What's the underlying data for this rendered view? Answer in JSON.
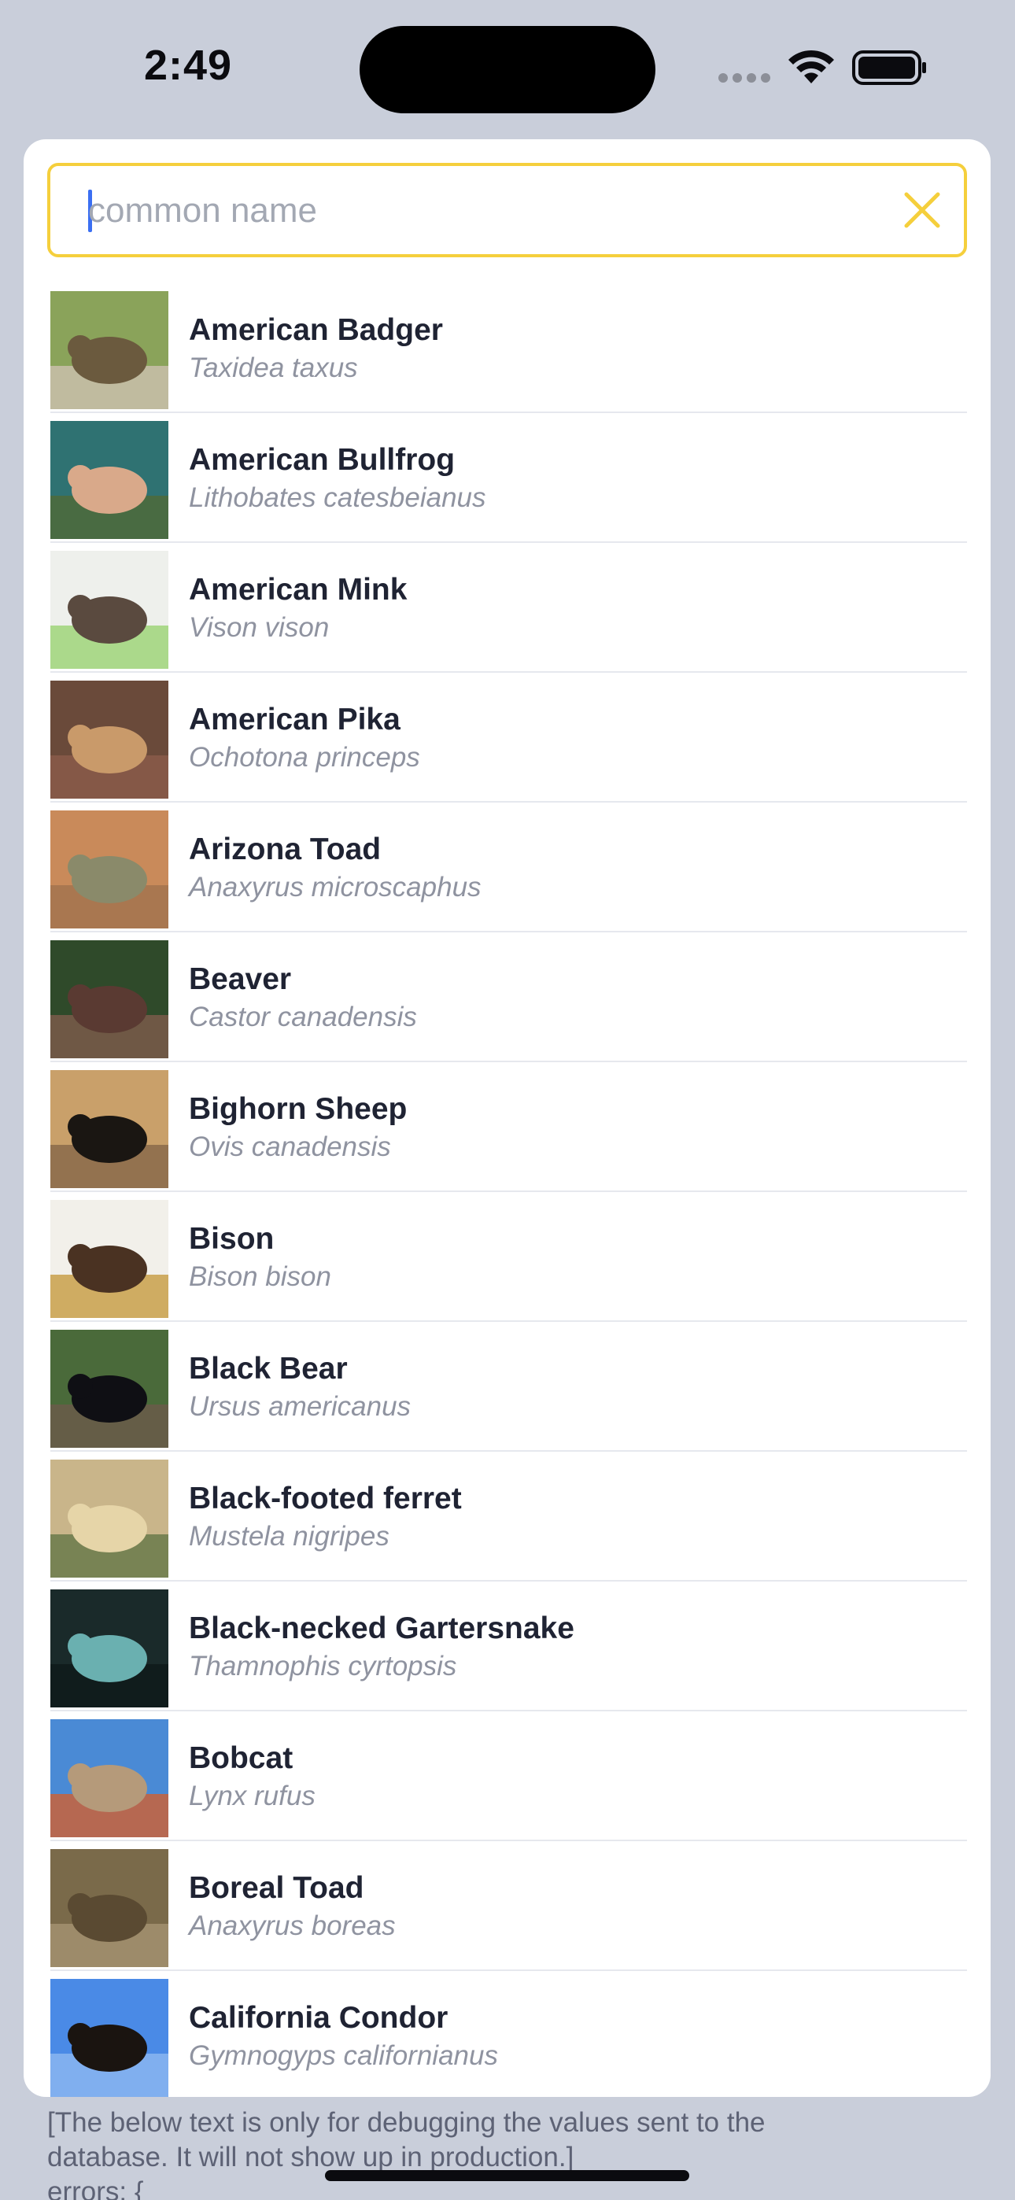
{
  "status_bar": {
    "time": "2:49"
  },
  "search": {
    "placeholder": "common name",
    "value": "",
    "clear_icon": "close-x-icon",
    "accent_color": "#f5cf3c"
  },
  "species": [
    {
      "common": "American Badger",
      "scientific": "Taxidea taxus",
      "colors": [
        "#8aa35a",
        "#6b5a3e",
        "#c9c0ac"
      ]
    },
    {
      "common": "American Bullfrog",
      "scientific": "Lithobates catesbeianus",
      "colors": [
        "#2f7272",
        "#d9a98a",
        "#4d6a3a"
      ]
    },
    {
      "common": "American Mink",
      "scientific": "Vison vison",
      "colors": [
        "#eef0ec",
        "#5a4a3f",
        "#9fd57a"
      ]
    },
    {
      "common": "American Pika",
      "scientific": "Ochotona princeps",
      "colors": [
        "#6a4a3a",
        "#c99a6a",
        "#8a5a4a"
      ]
    },
    {
      "common": "Arizona Toad",
      "scientific": "Anaxyrus microscaphus",
      "colors": [
        "#c98a5a",
        "#8a8a6a",
        "#a3734f"
      ]
    },
    {
      "common": "Beaver",
      "scientific": "Castor canadensis",
      "colors": [
        "#2f4a2a",
        "#5a3a32",
        "#7a5a4a"
      ]
    },
    {
      "common": "Bighorn Sheep",
      "scientific": "Ovis canadensis",
      "colors": [
        "#c9a06a",
        "#1a1612",
        "#8a6a4a"
      ]
    },
    {
      "common": "Bison",
      "scientific": "Bison bison",
      "colors": [
        "#f2f0ea",
        "#4a3222",
        "#c9a04a"
      ]
    },
    {
      "common": "Black Bear",
      "scientific": "Ursus americanus",
      "colors": [
        "#4a6a3a",
        "#0f0f14",
        "#6a5a4a"
      ]
    },
    {
      "common": "Black-footed ferret",
      "scientific": "Mustela nigripes",
      "colors": [
        "#c9b58a",
        "#e6d5a8",
        "#6a7a4a"
      ]
    },
    {
      "common": "Black-necked Gartersnake",
      "scientific": "Thamnophis cyrtopsis",
      "colors": [
        "#1a2a2a",
        "#6ab0b0",
        "#0f1a1a"
      ]
    },
    {
      "common": "Bobcat",
      "scientific": "Lynx rufus",
      "colors": [
        "#4a8ad5",
        "#b59a7a",
        "#c9623a"
      ]
    },
    {
      "common": "Boreal Toad",
      "scientific": "Anaxyrus boreas",
      "colors": [
        "#7a6a4a",
        "#5a4a32",
        "#a39070"
      ]
    },
    {
      "common": "California Condor",
      "scientific": "Gymnogyps californianus",
      "colors": [
        "#4a8ae6",
        "#1a1410",
        "#8ab5f0"
      ]
    }
  ],
  "debug": {
    "line1": "[The below text is only for debugging the values sent to the",
    "line2": "database. It will not show up in production.]",
    "line3": "errors: {"
  }
}
